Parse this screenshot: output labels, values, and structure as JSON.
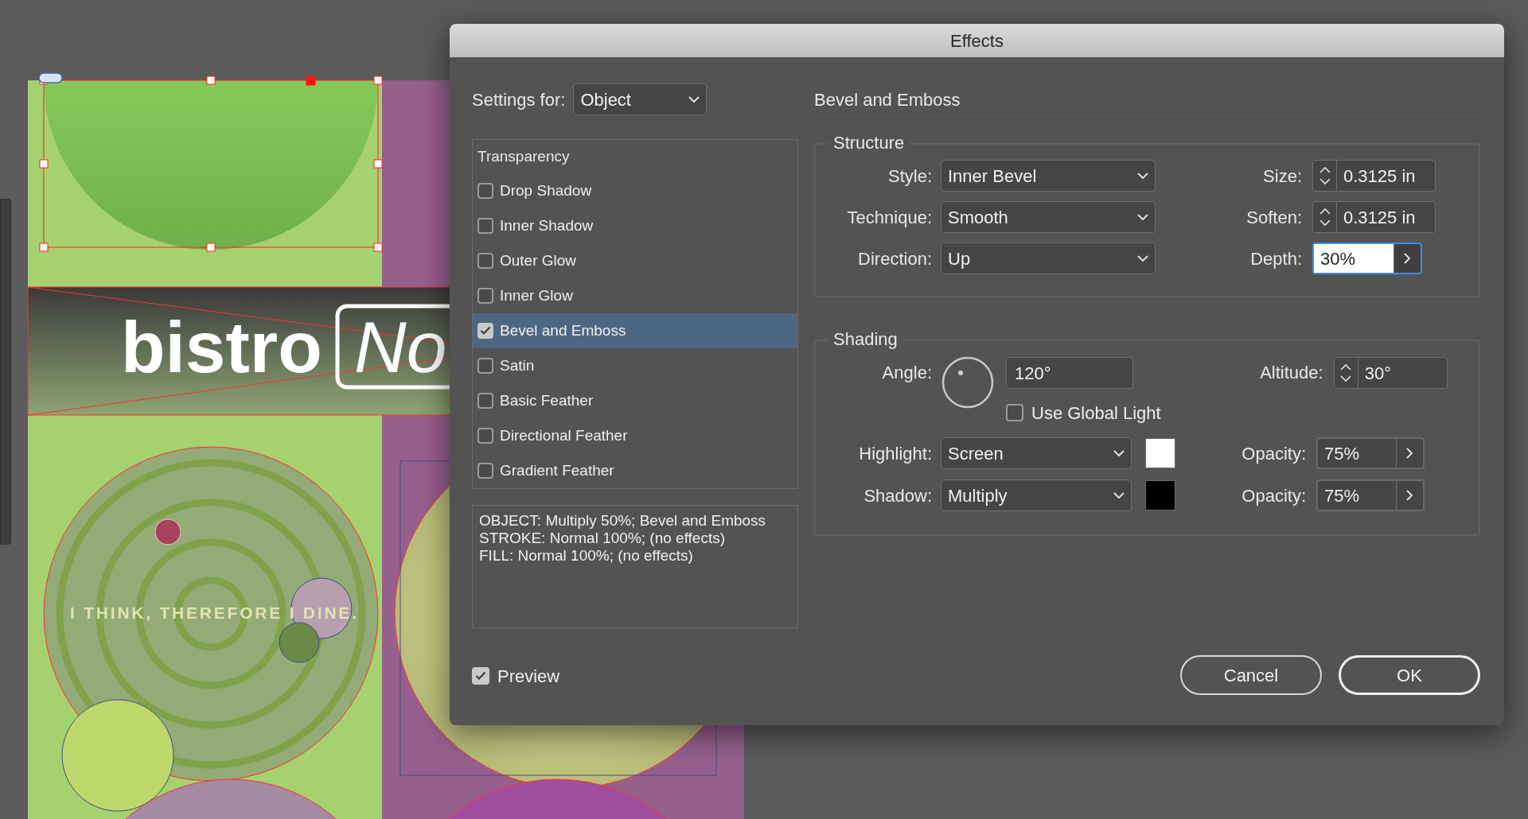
{
  "document": {
    "headline": "bistro",
    "headline_boxed": "No",
    "tagline": "I THINK, THEREFORE I DINE."
  },
  "dialog": {
    "title": "Effects",
    "settings_for": {
      "label": "Settings for:",
      "value": "Object"
    },
    "effects_list": {
      "header": "Transparency",
      "items": [
        {
          "label": "Drop Shadow",
          "checked": false,
          "selected": false
        },
        {
          "label": "Inner Shadow",
          "checked": false,
          "selected": false
        },
        {
          "label": "Outer Glow",
          "checked": false,
          "selected": false
        },
        {
          "label": "Inner Glow",
          "checked": false,
          "selected": false
        },
        {
          "label": "Bevel and Emboss",
          "checked": true,
          "selected": true
        },
        {
          "label": "Satin",
          "checked": false,
          "selected": false
        },
        {
          "label": "Basic Feather",
          "checked": false,
          "selected": false
        },
        {
          "label": "Directional Feather",
          "checked": false,
          "selected": false
        },
        {
          "label": "Gradient Feather",
          "checked": false,
          "selected": false
        }
      ]
    },
    "summary": [
      "OBJECT: Multiply 50%; Bevel and Emboss",
      "STROKE: Normal 100%; (no effects)",
      "FILL: Normal 100%; (no effects)"
    ],
    "preview": {
      "label": "Preview",
      "checked": true
    },
    "panel_title": "Bevel and Emboss",
    "structure": {
      "title": "Structure",
      "rows": [
        {
          "left": {
            "label": "Style:",
            "value": "Inner Bevel"
          },
          "right": {
            "label": "Size:",
            "value": "0.3125 in",
            "kind": "spinner",
            "focused": false
          }
        },
        {
          "left": {
            "label": "Technique:",
            "value": "Smooth"
          },
          "right": {
            "label": "Soften:",
            "value": "0.3125 in",
            "kind": "spinner",
            "focused": false
          }
        },
        {
          "left": {
            "label": "Direction:",
            "value": "Up"
          },
          "right": {
            "label": "Depth:",
            "value": "30%",
            "kind": "slider",
            "focused": true
          }
        }
      ]
    },
    "shading": {
      "title": "Shading",
      "angle": {
        "label": "Angle:",
        "value": "120°"
      },
      "altitude": {
        "label": "Altitude:",
        "value": "30°"
      },
      "use_global_light": {
        "label": "Use Global Light",
        "checked": false
      },
      "rows": [
        {
          "label": "Highlight:",
          "mode": "Screen",
          "color": "#ffffff",
          "opacity_label": "Opacity:",
          "opacity": "75%"
        },
        {
          "label": "Shadow:",
          "mode": "Multiply",
          "color": "#000000",
          "opacity_label": "Opacity:",
          "opacity": "75%"
        }
      ]
    },
    "buttons": [
      {
        "label": "Cancel",
        "default": false
      },
      {
        "label": "OK",
        "default": true
      }
    ]
  }
}
